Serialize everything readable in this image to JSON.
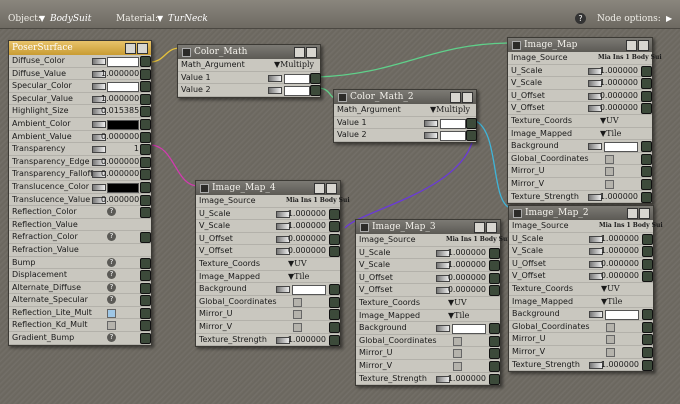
{
  "toolbar": {
    "object_label": "Object:",
    "object_value": "BodySuit",
    "material_label": "Material:",
    "material_value": "TurNeck",
    "help_icon": "?",
    "node_options_label": "Node options:"
  },
  "poser_surface": {
    "title": "PoserSurface",
    "rows": [
      {
        "label": "Diffuse_Color",
        "type": "color",
        "value": ""
      },
      {
        "label": "Diffuse_Value",
        "type": "num",
        "value": "1.000000"
      },
      {
        "label": "Specular_Color",
        "type": "color",
        "value": ""
      },
      {
        "label": "Specular_Value",
        "type": "num",
        "value": "1.000000"
      },
      {
        "label": "Highlight_Size",
        "type": "num",
        "value": "0.015385"
      },
      {
        "label": "Ambient_Color",
        "type": "black",
        "value": ""
      },
      {
        "label": "Ambient_Value",
        "type": "num",
        "value": "0.000000"
      },
      {
        "label": "Transparency",
        "type": "num",
        "value": "1"
      },
      {
        "label": "Transparency_Edge",
        "type": "num",
        "value": "0.000000"
      },
      {
        "label": "Transparency_Falloff",
        "type": "num",
        "value": "0.000000"
      },
      {
        "label": "Translucence_Color",
        "type": "black",
        "value": ""
      },
      {
        "label": "Translucence_Value",
        "type": "num",
        "value": "0.000000"
      },
      {
        "label": "Reflection_Color",
        "type": "help",
        "value": ""
      },
      {
        "label": "Reflection_Value",
        "type": "plain",
        "value": ""
      },
      {
        "label": "Refraction_Color",
        "type": "help",
        "value": ""
      },
      {
        "label": "Refraction_Value",
        "type": "plain",
        "value": ""
      },
      {
        "label": "Bump",
        "type": "help",
        "value": ""
      },
      {
        "label": "Displacement",
        "type": "help",
        "value": ""
      },
      {
        "label": "Alternate_Diffuse",
        "type": "help",
        "value": ""
      },
      {
        "label": "Alternate_Specular",
        "type": "help",
        "value": ""
      },
      {
        "label": "Reflection_Lite_Mult",
        "type": "checkon",
        "value": ""
      },
      {
        "label": "Reflection_Kd_Mult",
        "type": "check",
        "value": ""
      },
      {
        "label": "Gradient_Bump",
        "type": "help",
        "value": ""
      }
    ]
  },
  "color_math": {
    "title": "Color_Math",
    "argument_label": "Math_Argument",
    "argument_value": "Multiply",
    "value1_label": "Value 1",
    "value2_label": "Value 2"
  },
  "color_math_2": {
    "title": "Color_Math_2",
    "argument_label": "Math_Argument",
    "argument_value": "Multiply",
    "value1_label": "Value 1",
    "value2_label": "Value 2"
  },
  "image_maps": [
    {
      "id": "im1",
      "title": "Image_Map",
      "source": "Mia Ins 1 Body Sui"
    },
    {
      "id": "im4",
      "title": "Image_Map_4",
      "source": "Mia Ins 1 Body Sui"
    },
    {
      "id": "im3",
      "title": "Image_Map_3",
      "source": "Mia Ins 1 Body Sui"
    },
    {
      "id": "im2",
      "title": "Image_Map_2",
      "source": "Mia Ins 1 Body Sui"
    }
  ],
  "image_map_fields": {
    "image_source": "Image_Source",
    "u_scale": "U_Scale",
    "u_scale_val": "1.000000",
    "v_scale": "V_Scale",
    "v_scale_val": "1.000000",
    "u_offset": "U_Offset",
    "u_offset_val": "0.000000",
    "v_offset": "V_Offset",
    "v_offset_val": "0.000000",
    "texture_coords": "Texture_Coords",
    "texture_coords_val": "UV",
    "image_mapped": "Image_Mapped",
    "image_mapped_val": "Tile",
    "background": "Background",
    "global_coords": "Global_Coordinates",
    "mirror_u": "Mirror_U",
    "mirror_v": "Mirror_V",
    "texture_strength": "Texture_Strength",
    "texture_strength_val": "1.000000"
  },
  "colors": {
    "wire_yellow": "#e6c23a",
    "wire_green": "#5fd08a",
    "wire_cyan": "#3fb4d8",
    "wire_magenta": "#d23ab0",
    "wire_purple": "#6a3ad8",
    "poser_title": "#e0b653"
  }
}
